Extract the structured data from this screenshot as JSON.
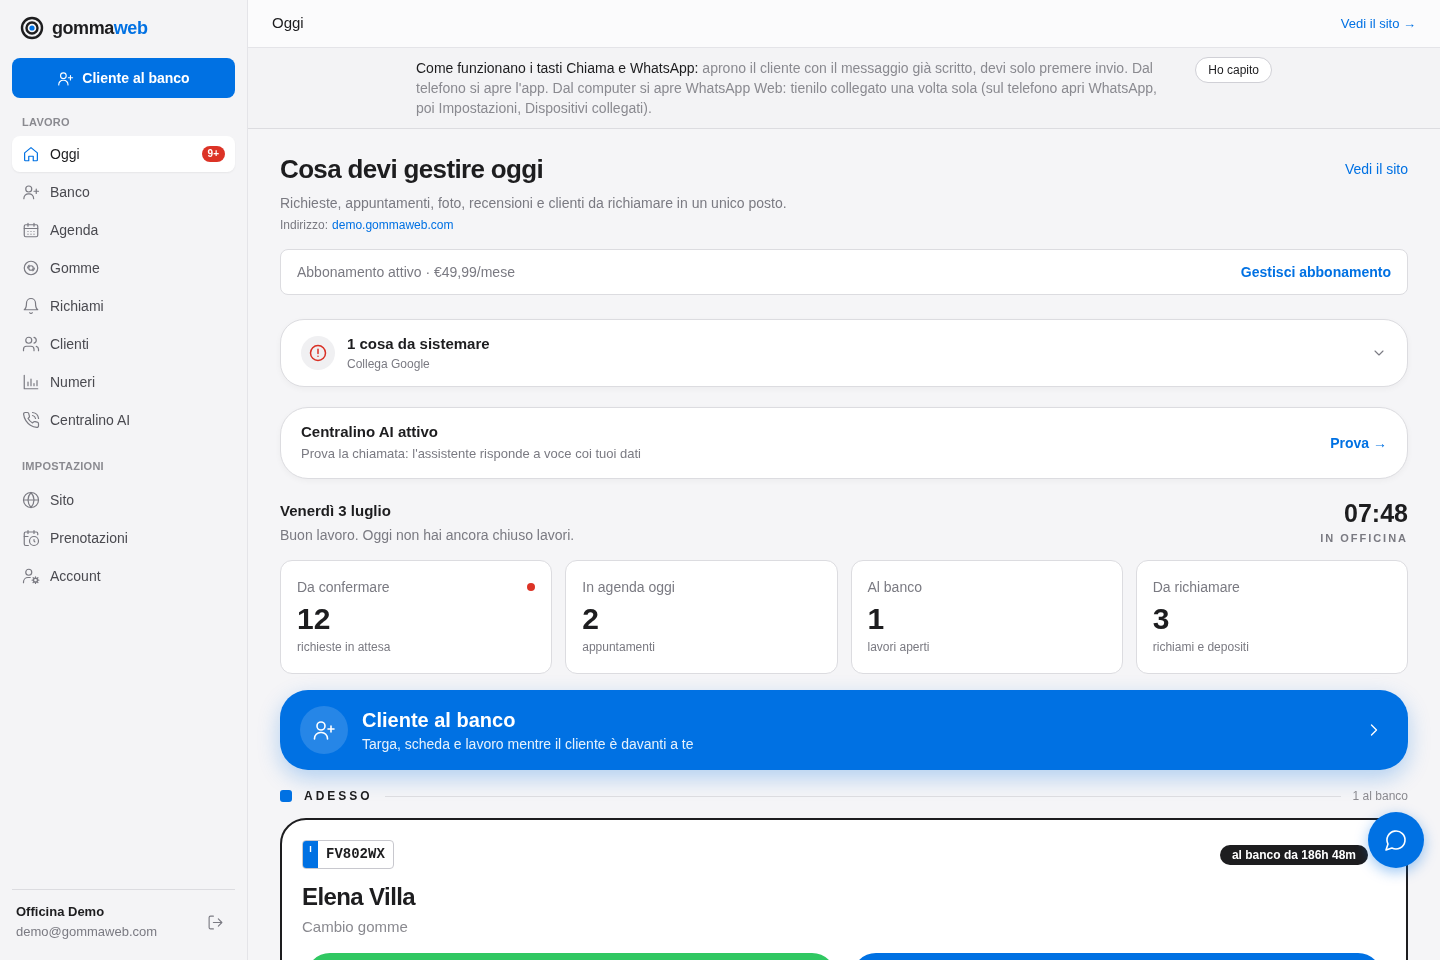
{
  "brand": {
    "name_start": "gomma",
    "name_end": "web"
  },
  "sidebar": {
    "primary_button": "Cliente al banco",
    "sections": [
      {
        "title": "LAVORO",
        "items": [
          {
            "label": "Oggi",
            "selected": true,
            "badge": "9+"
          },
          {
            "label": "Banco",
            "selected": false
          },
          {
            "label": "Agenda",
            "selected": false
          },
          {
            "label": "Gomme",
            "selected": false
          },
          {
            "label": "Richiami",
            "selected": false
          },
          {
            "label": "Clienti",
            "selected": false
          },
          {
            "label": "Numeri",
            "selected": false
          },
          {
            "label": "Centralino AI",
            "selected": false
          }
        ]
      },
      {
        "title": "IMPOSTAZIONI",
        "items": [
          {
            "label": "Sito",
            "selected": false
          },
          {
            "label": "Prenotazioni",
            "selected": false
          },
          {
            "label": "Account",
            "selected": false
          }
        ]
      }
    ],
    "account": {
      "name": "Officina Demo",
      "email": "demo@gommaweb.com"
    }
  },
  "header": {
    "title": "Oggi",
    "link": "Vedi il sito →"
  },
  "notice": {
    "text": "**Come funzionano i tasti Chiama e WhatsApp:** aprono il cliente con il messaggio già scritto, devi solo premere invio. Dal telefono si apre l'app. Dal computer si apre WhatsApp Web: tienilo collegato una volta sola (sul telefono apri WhatsApp, poi Impostazioni, Dispositivi collegati).",
    "button": "Ho capito"
  },
  "page": {
    "title": "Cosa devi gestire oggi",
    "link": "Vedi il sito",
    "subtitle": "Richieste, appuntamenti, foto, recensioni e clienti da richiamare in un unico posto.",
    "address_label": "Indirizzo:",
    "address": "demo.gommaweb.com"
  },
  "subscription": {
    "status": "Abbonamento attivo · €49,99/mese",
    "action": "Gestisci abbonamento"
  },
  "issues": {
    "title": "1 cosa da sistemare",
    "detail": "Collega Google",
    "expanded": false
  },
  "assistant": {
    "title": "Centralino AI attivo",
    "description": "Prova la chiamata: l'assistente risponde a voce coi tuoi dati",
    "action": "Prova →"
  },
  "today": {
    "date": "Venerdì 3 luglio",
    "message": "Buon lavoro. Oggi non hai ancora chiuso lavori.",
    "time": "07:48",
    "time_label": "IN OFFICINA"
  },
  "stats": [
    {
      "label": "Da confermare",
      "value": "12",
      "caption": "richieste in attesa",
      "alert": true
    },
    {
      "label": "In agenda oggi",
      "value": "2",
      "caption": "appuntamenti",
      "alert": false
    },
    {
      "label": "Al banco",
      "value": "1",
      "caption": "lavori aperti",
      "alert": false
    },
    {
      "label": "Da richiamare",
      "value": "3",
      "caption": "richiami e depositi",
      "alert": false
    }
  ],
  "counter_banner": {
    "title": "Cliente al banco",
    "subtitle": "Targa, scheda e lavoro mentre il cliente è davanti a te"
  },
  "now": {
    "title": "ADESSO",
    "count": "1 al banco",
    "entries": [
      {
        "plate_country": "I",
        "plate": "FV802WX",
        "elapsed": "al banco da 186h 48m",
        "customer": "Elena Villa",
        "service": "Cambio gomme",
        "actions": [
          {
            "color": "#30c862"
          },
          {
            "color": "#0071e3"
          }
        ]
      }
    ]
  }
}
